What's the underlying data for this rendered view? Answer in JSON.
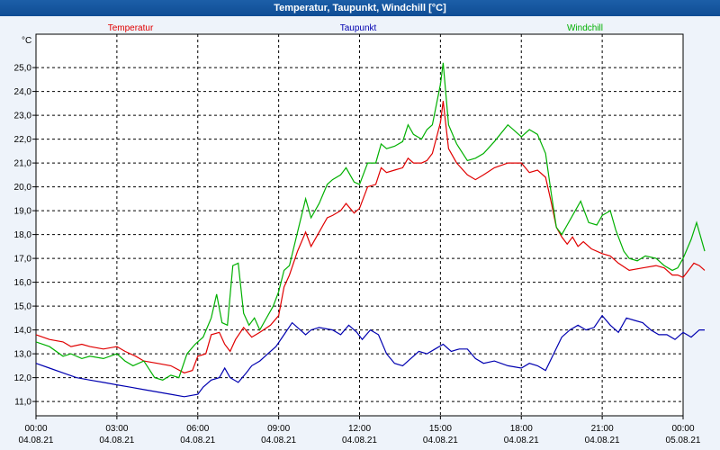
{
  "window": {
    "title": "Temperatur, Taupunkt, Windchill [°C]"
  },
  "chart_data": {
    "type": "line",
    "title": "Temperatur, Taupunkt, Windchill [°C]",
    "ylabel": "°C",
    "ylim": [
      10.4,
      26.4
    ],
    "y_ticks": [
      "11,0",
      "12,0",
      "13,0",
      "14,0",
      "15,0",
      "16,0",
      "17,0",
      "18,0",
      "19,0",
      "20,0",
      "21,0",
      "22,0",
      "23,0",
      "24,0",
      "25,0"
    ],
    "x_hours_range": [
      0,
      24
    ],
    "x_ticks": [
      {
        "time": "00:00",
        "date": "04.08.21"
      },
      {
        "time": "03:00",
        "date": "04.08.21"
      },
      {
        "time": "06:00",
        "date": "04.08.21"
      },
      {
        "time": "09:00",
        "date": "04.08.21"
      },
      {
        "time": "12:00",
        "date": "04.08.21"
      },
      {
        "time": "15:00",
        "date": "04.08.21"
      },
      {
        "time": "18:00",
        "date": "04.08.21"
      },
      {
        "time": "21:00",
        "date": "04.08.21"
      },
      {
        "time": "00:00",
        "date": "05.08.21"
      }
    ],
    "grid": true,
    "legend_position": "top",
    "series": [
      {
        "name": "Temperatur",
        "color": "#e00000",
        "points": [
          [
            0,
            13.8
          ],
          [
            0.5,
            13.6
          ],
          [
            1,
            13.5
          ],
          [
            1.3,
            13.3
          ],
          [
            1.7,
            13.4
          ],
          [
            2,
            13.3
          ],
          [
            2.5,
            13.2
          ],
          [
            3,
            13.3
          ],
          [
            3.3,
            13.1
          ],
          [
            3.7,
            12.9
          ],
          [
            4,
            12.7
          ],
          [
            4.5,
            12.6
          ],
          [
            5,
            12.5
          ],
          [
            5.5,
            12.2
          ],
          [
            5.8,
            12.3
          ],
          [
            6,
            12.9
          ],
          [
            6.3,
            13.0
          ],
          [
            6.5,
            13.8
          ],
          [
            6.8,
            13.9
          ],
          [
            7,
            13.4
          ],
          [
            7.2,
            13.1
          ],
          [
            7.4,
            13.6
          ],
          [
            7.7,
            14.1
          ],
          [
            8,
            13.7
          ],
          [
            8.3,
            13.9
          ],
          [
            8.7,
            14.2
          ],
          [
            9,
            14.6
          ],
          [
            9.2,
            15.8
          ],
          [
            9.4,
            16.3
          ],
          [
            9.7,
            17.3
          ],
          [
            10,
            18.1
          ],
          [
            10.2,
            17.5
          ],
          [
            10.5,
            18.1
          ],
          [
            10.8,
            18.7
          ],
          [
            11,
            18.8
          ],
          [
            11.3,
            19.0
          ],
          [
            11.5,
            19.3
          ],
          [
            11.8,
            18.9
          ],
          [
            12,
            19.1
          ],
          [
            12.3,
            20.0
          ],
          [
            12.6,
            20.1
          ],
          [
            12.8,
            20.8
          ],
          [
            13,
            20.6
          ],
          [
            13.3,
            20.7
          ],
          [
            13.6,
            20.8
          ],
          [
            13.8,
            21.2
          ],
          [
            14,
            21.0
          ],
          [
            14.3,
            21.0
          ],
          [
            14.5,
            21.1
          ],
          [
            14.7,
            21.4
          ],
          [
            15,
            22.7
          ],
          [
            15.1,
            23.6
          ],
          [
            15.3,
            21.6
          ],
          [
            15.6,
            21.0
          ],
          [
            16,
            20.5
          ],
          [
            16.3,
            20.3
          ],
          [
            16.6,
            20.5
          ],
          [
            17,
            20.8
          ],
          [
            17.5,
            21.0
          ],
          [
            18,
            21.0
          ],
          [
            18.3,
            20.6
          ],
          [
            18.6,
            20.7
          ],
          [
            18.9,
            20.4
          ],
          [
            19.1,
            19.4
          ],
          [
            19.3,
            18.3
          ],
          [
            19.5,
            17.9
          ],
          [
            19.7,
            17.6
          ],
          [
            19.9,
            17.9
          ],
          [
            20.1,
            17.5
          ],
          [
            20.3,
            17.7
          ],
          [
            20.6,
            17.4
          ],
          [
            21,
            17.2
          ],
          [
            21.3,
            17.1
          ],
          [
            21.6,
            16.8
          ],
          [
            22,
            16.5
          ],
          [
            22.5,
            16.6
          ],
          [
            23,
            16.7
          ],
          [
            23.3,
            16.6
          ],
          [
            23.6,
            16.3
          ],
          [
            23.8,
            16.3
          ],
          [
            24,
            16.2
          ],
          [
            24.2,
            16.5
          ],
          [
            24.4,
            16.8
          ],
          [
            24.6,
            16.7
          ],
          [
            24.8,
            16.5
          ]
        ]
      },
      {
        "name": "Taupunkt",
        "color": "#0000b0",
        "points": [
          [
            0,
            12.6
          ],
          [
            0.5,
            12.4
          ],
          [
            1,
            12.2
          ],
          [
            1.5,
            12.0
          ],
          [
            2,
            11.9
          ],
          [
            2.5,
            11.8
          ],
          [
            3,
            11.7
          ],
          [
            3.5,
            11.6
          ],
          [
            4,
            11.5
          ],
          [
            4.5,
            11.4
          ],
          [
            5,
            11.3
          ],
          [
            5.5,
            11.2
          ],
          [
            6,
            11.3
          ],
          [
            6.2,
            11.6
          ],
          [
            6.5,
            11.9
          ],
          [
            6.8,
            12.0
          ],
          [
            7,
            12.4
          ],
          [
            7.2,
            12.0
          ],
          [
            7.5,
            11.8
          ],
          [
            7.8,
            12.2
          ],
          [
            8,
            12.5
          ],
          [
            8.3,
            12.7
          ],
          [
            8.6,
            13.0
          ],
          [
            8.9,
            13.3
          ],
          [
            9.2,
            13.8
          ],
          [
            9.5,
            14.3
          ],
          [
            9.8,
            14.0
          ],
          [
            10,
            13.8
          ],
          [
            10.2,
            14.0
          ],
          [
            10.5,
            14.1
          ],
          [
            11,
            14.0
          ],
          [
            11.3,
            13.8
          ],
          [
            11.6,
            14.2
          ],
          [
            11.9,
            13.9
          ],
          [
            12.1,
            13.6
          ],
          [
            12.4,
            14.0
          ],
          [
            12.7,
            13.8
          ],
          [
            13,
            13.0
          ],
          [
            13.3,
            12.6
          ],
          [
            13.6,
            12.5
          ],
          [
            13.9,
            12.8
          ],
          [
            14.2,
            13.1
          ],
          [
            14.5,
            13.0
          ],
          [
            14.8,
            13.2
          ],
          [
            15.1,
            13.4
          ],
          [
            15.4,
            13.1
          ],
          [
            15.7,
            13.2
          ],
          [
            16,
            13.2
          ],
          [
            16.3,
            12.8
          ],
          [
            16.6,
            12.6
          ],
          [
            17,
            12.7
          ],
          [
            17.5,
            12.5
          ],
          [
            18,
            12.4
          ],
          [
            18.3,
            12.6
          ],
          [
            18.6,
            12.5
          ],
          [
            18.9,
            12.3
          ],
          [
            19.2,
            13.0
          ],
          [
            19.5,
            13.7
          ],
          [
            19.8,
            14.0
          ],
          [
            20.1,
            14.2
          ],
          [
            20.4,
            14.0
          ],
          [
            20.7,
            14.1
          ],
          [
            21,
            14.6
          ],
          [
            21.3,
            14.2
          ],
          [
            21.6,
            13.9
          ],
          [
            21.9,
            14.5
          ],
          [
            22.2,
            14.4
          ],
          [
            22.5,
            14.3
          ],
          [
            22.8,
            14.0
          ],
          [
            23.1,
            13.8
          ],
          [
            23.4,
            13.8
          ],
          [
            23.7,
            13.6
          ],
          [
            24,
            13.9
          ],
          [
            24.3,
            13.7
          ],
          [
            24.6,
            14.0
          ],
          [
            24.8,
            14.0
          ]
        ]
      },
      {
        "name": "Windchill",
        "color": "#00b000",
        "points": [
          [
            0,
            13.5
          ],
          [
            0.5,
            13.3
          ],
          [
            1,
            12.9
          ],
          [
            1.3,
            13.0
          ],
          [
            1.7,
            12.8
          ],
          [
            2,
            12.9
          ],
          [
            2.5,
            12.8
          ],
          [
            3,
            13.0
          ],
          [
            3.3,
            12.7
          ],
          [
            3.6,
            12.5
          ],
          [
            4,
            12.7
          ],
          [
            4.4,
            12.0
          ],
          [
            4.7,
            11.9
          ],
          [
            5,
            12.1
          ],
          [
            5.3,
            12.0
          ],
          [
            5.6,
            13.0
          ],
          [
            5.9,
            13.4
          ],
          [
            6.2,
            13.7
          ],
          [
            6.5,
            14.5
          ],
          [
            6.7,
            15.5
          ],
          [
            6.9,
            14.3
          ],
          [
            7.1,
            14.2
          ],
          [
            7.3,
            16.7
          ],
          [
            7.5,
            16.8
          ],
          [
            7.7,
            14.7
          ],
          [
            7.9,
            14.2
          ],
          [
            8.1,
            14.5
          ],
          [
            8.3,
            14.0
          ],
          [
            8.5,
            14.4
          ],
          [
            8.8,
            15.0
          ],
          [
            9,
            15.6
          ],
          [
            9.2,
            16.5
          ],
          [
            9.4,
            16.7
          ],
          [
            9.7,
            18.1
          ],
          [
            10,
            19.5
          ],
          [
            10.2,
            18.7
          ],
          [
            10.5,
            19.3
          ],
          [
            10.8,
            20.1
          ],
          [
            11,
            20.3
          ],
          [
            11.3,
            20.5
          ],
          [
            11.5,
            20.8
          ],
          [
            11.8,
            20.2
          ],
          [
            12,
            20.1
          ],
          [
            12.3,
            21.0
          ],
          [
            12.6,
            21.0
          ],
          [
            12.8,
            21.8
          ],
          [
            13,
            21.6
          ],
          [
            13.3,
            21.7
          ],
          [
            13.6,
            21.9
          ],
          [
            13.8,
            22.6
          ],
          [
            14,
            22.2
          ],
          [
            14.3,
            22.0
          ],
          [
            14.5,
            22.4
          ],
          [
            14.7,
            22.6
          ],
          [
            15,
            24.3
          ],
          [
            15.1,
            25.2
          ],
          [
            15.3,
            22.6
          ],
          [
            15.6,
            21.8
          ],
          [
            16,
            21.1
          ],
          [
            16.3,
            21.2
          ],
          [
            16.6,
            21.4
          ],
          [
            17,
            21.9
          ],
          [
            17.5,
            22.6
          ],
          [
            18,
            22.1
          ],
          [
            18.3,
            22.4
          ],
          [
            18.6,
            22.2
          ],
          [
            18.9,
            21.4
          ],
          [
            19.1,
            19.8
          ],
          [
            19.3,
            18.3
          ],
          [
            19.5,
            18.0
          ],
          [
            19.7,
            18.4
          ],
          [
            20,
            19.0
          ],
          [
            20.2,
            19.4
          ],
          [
            20.5,
            18.5
          ],
          [
            20.8,
            18.4
          ],
          [
            21,
            18.8
          ],
          [
            21.3,
            19.0
          ],
          [
            21.5,
            18.2
          ],
          [
            21.8,
            17.3
          ],
          [
            22,
            17.0
          ],
          [
            22.3,
            16.9
          ],
          [
            22.6,
            17.1
          ],
          [
            23,
            17.0
          ],
          [
            23.3,
            16.7
          ],
          [
            23.6,
            16.5
          ],
          [
            23.8,
            16.6
          ],
          [
            24,
            17.0
          ],
          [
            24.3,
            17.8
          ],
          [
            24.5,
            18.5
          ],
          [
            24.8,
            17.3
          ]
        ]
      }
    ]
  }
}
